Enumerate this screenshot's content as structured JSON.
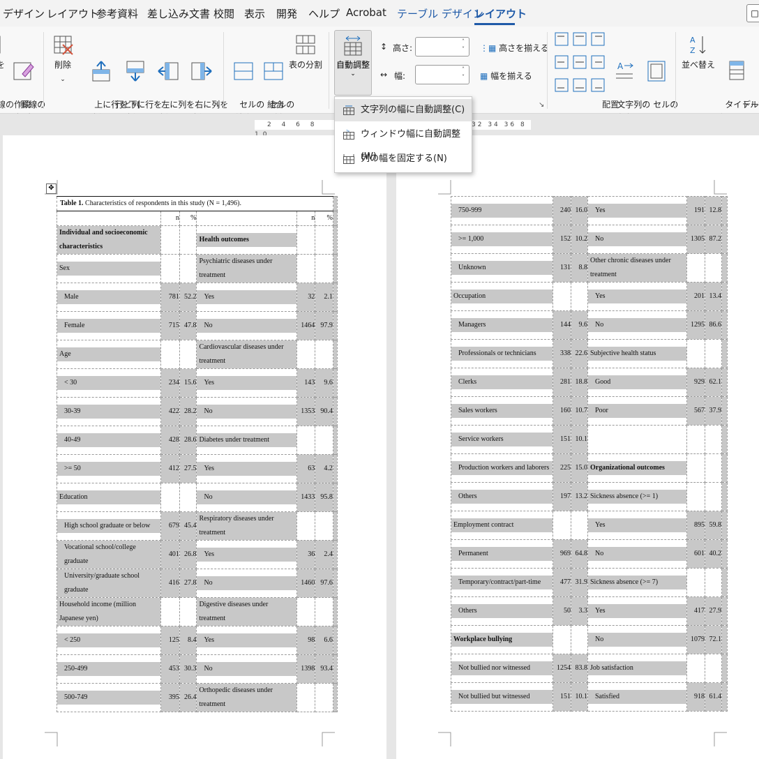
{
  "tabs": [
    "デザイン",
    "レイアウト",
    "参考資料",
    "差し込み文書",
    "校閲",
    "表示",
    "開発",
    "ヘルプ",
    "Acrobat",
    "テーブル デザイン",
    "レイアウト"
  ],
  "ribbon": {
    "draw": {
      "erase_partial": "を",
      "erase_lines": "罫線の\n削除",
      "group": "線の作成"
    },
    "rows_cols": {
      "delete": "削除",
      "insert_above": "上に行を\n挿入",
      "insert_below": "下に行を\n挿入",
      "insert_left": "左に列を\n挿入",
      "insert_right": "右に列を\n挿入",
      "group": "行と列"
    },
    "merge": {
      "merge_cells": "セルの\n結合",
      "split_cells": "セルの\n分割",
      "split_table": "表の分割",
      "group": "結合"
    },
    "cellsize": {
      "autofit": "自動調整",
      "height_label": "高さ:",
      "width_label": "幅:",
      "distribute_rows": "高さを揃える",
      "distribute_cols": "幅を揃える"
    },
    "alignment": {
      "text_direction": "文字列の\n方向",
      "cell_margins": "セルの\n配置",
      "group": "配置"
    },
    "data": {
      "sort": "並べ替え",
      "repeat_header": "タイトル行の\n繰り返し",
      "group": "データ"
    }
  },
  "autofit_menu": [
    {
      "label": "文字列の幅に自動調整(C)"
    },
    {
      "label": "ウィンドウ幅に自動調整(W)"
    },
    {
      "label": "列の幅を固定する(N)"
    }
  ],
  "ruler": {
    "left": "2 4 6 8 10",
    "right": "32 34 36 8"
  },
  "table_left": {
    "title": "Table 1. Characteristics of respondents in this study (N = 1,496).",
    "head_n": "n",
    "head_pct": "%",
    "rows": [
      {
        "l": "Individual and socioeconomic characteristics",
        "ln": "",
        "lp": "",
        "r": "Health outcomes",
        "rn": "",
        "rp": ""
      },
      {
        "l": "Sex",
        "ln": "",
        "lp": "",
        "r": "Psychiatric diseases under treatment",
        "rn": "",
        "rp": ""
      },
      {
        "l": "Male",
        "ln": "781",
        "lp": "52.2",
        "r": "Yes",
        "rn": "32",
        "rp": "2.1"
      },
      {
        "l": "Female",
        "ln": "715",
        "lp": "47.8",
        "r": "No",
        "rn": "1464",
        "rp": "97.9"
      },
      {
        "l": "Age",
        "ln": "",
        "lp": "",
        "r": "Cardiovascular diseases under treatment",
        "rn": "",
        "rp": ""
      },
      {
        "l": "< 30",
        "ln": "234",
        "lp": "15.6",
        "r": "Yes",
        "rn": "143",
        "rp": "9.6"
      },
      {
        "l": "30-39",
        "ln": "422",
        "lp": "28.2",
        "r": "No",
        "rn": "1353",
        "rp": "90.4"
      },
      {
        "l": "40-49",
        "ln": "428",
        "lp": "28.6",
        "r": "Diabetes under treatment",
        "rn": "",
        "rp": ""
      },
      {
        "l": ">= 50",
        "ln": "412",
        "lp": "27.5",
        "r": "Yes",
        "rn": "63",
        "rp": "4.2"
      },
      {
        "l": "Education",
        "ln": "",
        "lp": "",
        "r": "No",
        "rn": "1433",
        "rp": "95.8"
      },
      {
        "l": "High school graduate or below",
        "ln": "679",
        "lp": "45.4",
        "r": "Respiratory diseases under treatment",
        "rn": "",
        "rp": ""
      },
      {
        "l": "Vocational school/college graduate",
        "ln": "401",
        "lp": "26.8",
        "r": "Yes",
        "rn": "36",
        "rp": "2.4"
      },
      {
        "l": "University/graduate school graduate",
        "ln": "416",
        "lp": "27.8",
        "r": "No",
        "rn": "1460",
        "rp": "97.6"
      },
      {
        "l": "Household income (million Japanese yen)",
        "ln": "",
        "lp": "",
        "r": "Digestive diseases under treatment",
        "rn": "",
        "rp": ""
      },
      {
        "l": "< 250",
        "ln": "125",
        "lp": "8.4",
        "r": "Yes",
        "rn": "98",
        "rp": "6.6"
      },
      {
        "l": "250-499",
        "ln": "453",
        "lp": "30.3",
        "r": "No",
        "rn": "1398",
        "rp": "93.4"
      },
      {
        "l": "500-749",
        "ln": "395",
        "lp": "26.4",
        "r": "Orthopedic diseases under treatment",
        "rn": "",
        "rp": ""
      }
    ]
  },
  "table_right": {
    "rows": [
      {
        "l": "750-999",
        "ln": "240",
        "lp": "16.0",
        "r": "Yes",
        "rn": "191",
        "rp": "12.8"
      },
      {
        "l": ">= 1,000",
        "ln": "152",
        "lp": "10.2",
        "r": "No",
        "rn": "1305",
        "rp": "87.2"
      },
      {
        "l": "Unknown",
        "ln": "131",
        "lp": "8.8",
        "r": "Other chronic diseases under treatment",
        "rn": "",
        "rp": ""
      },
      {
        "l": "Occupation",
        "ln": "",
        "lp": "",
        "r": "Yes",
        "rn": "201",
        "rp": "13.4"
      },
      {
        "l": "Managers",
        "ln": "144",
        "lp": "9.6",
        "r": "No",
        "rn": "1295",
        "rp": "86.6"
      },
      {
        "l": "Professionals or technicians",
        "ln": "338",
        "lp": "22.6",
        "r": "Subjective health status",
        "rn": "",
        "rp": ""
      },
      {
        "l": "Clerks",
        "ln": "281",
        "lp": "18.8",
        "r": "Good",
        "rn": "929",
        "rp": "62.1"
      },
      {
        "l": "Sales workers",
        "ln": "160",
        "lp": "10.7",
        "r": "Poor",
        "rn": "567",
        "rp": "37.9"
      },
      {
        "l": "Service workers",
        "ln": "151",
        "lp": "10.1",
        "r": "",
        "rn": "",
        "rp": ""
      },
      {
        "l": "Production workers and laborers",
        "ln": "225",
        "lp": "15.0",
        "r": "Organizational outcomes",
        "rn": "",
        "rp": ""
      },
      {
        "l": "Others",
        "ln": "197",
        "lp": "13.2",
        "r": "Sickness absence (>= 1)",
        "rn": "",
        "rp": ""
      },
      {
        "l": "Employment contract",
        "ln": "",
        "lp": "",
        "r": "Yes",
        "rn": "895",
        "rp": "59.8"
      },
      {
        "l": "Permanent",
        "ln": "969",
        "lp": "64.8",
        "r": "No",
        "rn": "601",
        "rp": "40.2"
      },
      {
        "l": "Temporary/contract/part-time",
        "ln": "477",
        "lp": "31.9",
        "r": "Sickness absence (>= 7)",
        "rn": "",
        "rp": ""
      },
      {
        "l": "Others",
        "ln": "50",
        "lp": "3.3",
        "r": "Yes",
        "rn": "417",
        "rp": "27.9"
      },
      {
        "l": "Workplace bullying",
        "ln": "",
        "lp": "",
        "r": "No",
        "rn": "1079",
        "rp": "72.1"
      },
      {
        "l": "Not bullied nor witnessed",
        "ln": "1254",
        "lp": "83.8",
        "r": "Job satisfaction",
        "rn": "",
        "rp": ""
      },
      {
        "l": "Not bullied but witnessed",
        "ln": "151",
        "lp": "10.1",
        "r": "Satisfied",
        "rn": "918",
        "rp": "61.4"
      }
    ]
  }
}
